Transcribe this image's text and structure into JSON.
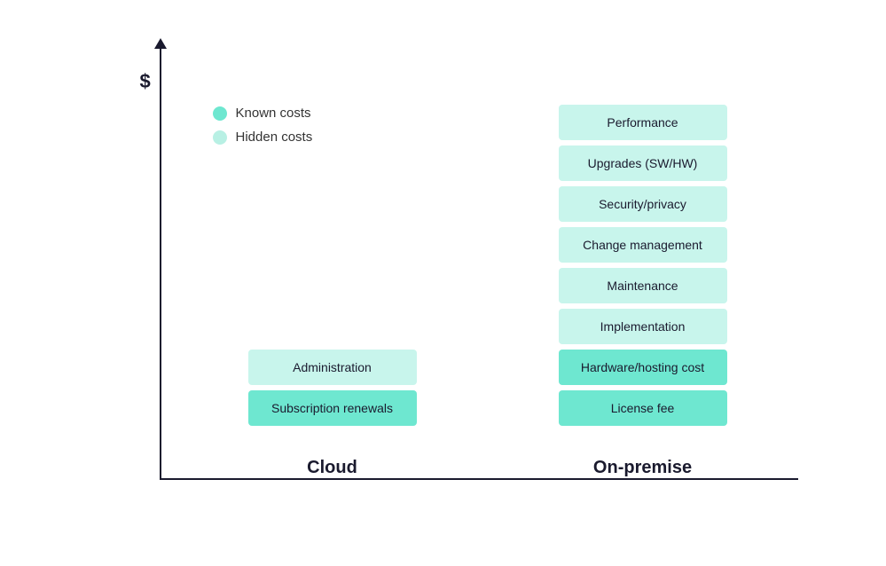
{
  "chart": {
    "y_axis_label": "$",
    "x_axis_line": true,
    "y_axis_line": true
  },
  "legend": {
    "items": [
      {
        "id": "known",
        "label": "Known costs",
        "type": "known"
      },
      {
        "id": "hidden",
        "label": "Hidden costs",
        "type": "hidden"
      }
    ]
  },
  "columns": [
    {
      "id": "cloud",
      "label": "Cloud",
      "boxes": [
        {
          "text": "Administration",
          "type": "hidden"
        },
        {
          "text": "Subscription renewals",
          "type": "known"
        }
      ]
    },
    {
      "id": "on-premise",
      "label": "On-premise",
      "boxes": [
        {
          "text": "Performance",
          "type": "hidden"
        },
        {
          "text": "Upgrades (SW/HW)",
          "type": "hidden"
        },
        {
          "text": "Security/privacy",
          "type": "hidden"
        },
        {
          "text": "Change management",
          "type": "hidden"
        },
        {
          "text": "Maintenance",
          "type": "hidden"
        },
        {
          "text": "Implementation",
          "type": "hidden"
        },
        {
          "text": "Hardware/hosting cost",
          "type": "known"
        },
        {
          "text": "License fee",
          "type": "known"
        }
      ]
    }
  ]
}
